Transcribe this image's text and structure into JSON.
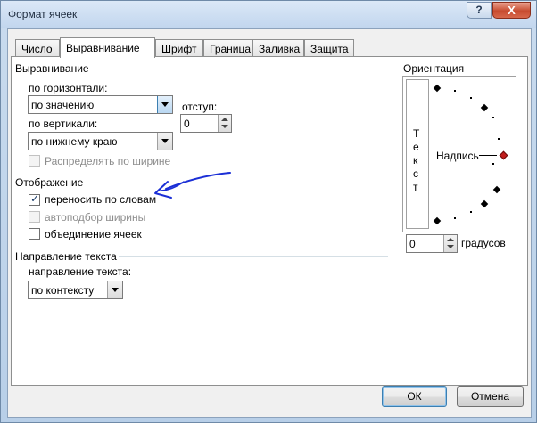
{
  "window": {
    "title": "Формат ячеек",
    "help": "?",
    "close": "X"
  },
  "tabs": [
    "Число",
    "Выравнивание",
    "Шрифт",
    "Граница",
    "Заливка",
    "Защита"
  ],
  "active_tab": "Выравнивание",
  "alignment": {
    "group_title": "Выравнивание",
    "horizontal_label": "по горизонтали:",
    "horizontal_value": "по значению",
    "indent_label": "отступ:",
    "indent_value": "0",
    "vertical_label": "по вертикали:",
    "vertical_value": "по нижнему краю",
    "distribute_label": "Распределять по ширине"
  },
  "display": {
    "group_title": "Отображение",
    "wrap_text_label": "переносить по словам",
    "shrink_label": "автоподбор ширины",
    "merge_label": "объединение ячеек"
  },
  "direction": {
    "group_title": "Направление текста",
    "label": "направление текста:",
    "value": "по контексту"
  },
  "orientation": {
    "group_title": "Ориентация",
    "vertical_text": [
      "Т",
      "е",
      "к",
      "с",
      "т"
    ],
    "inscription": "Надпись",
    "degrees_value": "0",
    "degrees_label": "градусов"
  },
  "buttons": {
    "ok": "ОК",
    "cancel": "Отмена"
  },
  "colors": {
    "accent": "#3c7fb1",
    "annotation": "#1b2fd6"
  }
}
